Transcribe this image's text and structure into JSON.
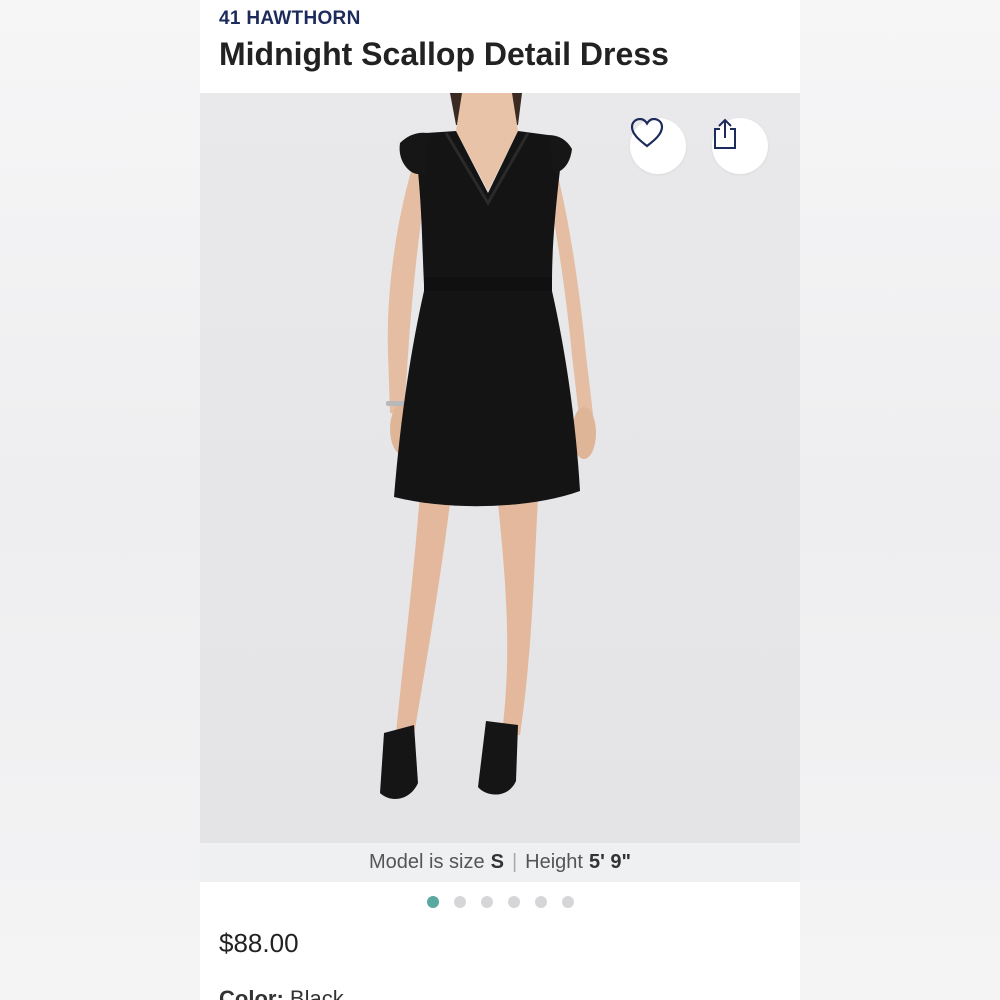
{
  "product": {
    "brand": "41 HAWTHORN",
    "title": "Midnight Scallop Detail Dress",
    "price": "$88.00",
    "color_label": "Color:",
    "color_value": "Black"
  },
  "icons": {
    "favorite": "heart-icon",
    "share": "share-icon"
  },
  "model_info": {
    "size_text": "Model is size",
    "size_value": "S",
    "separator": "|",
    "height_text": "Height",
    "height_value": "5' 9\""
  },
  "carousel": {
    "total": 6,
    "active_index": 0,
    "active_color": "#5aa9a0",
    "inactive_color": "#d6d6d9"
  },
  "colors": {
    "brand": "#1d2b5c",
    "dress": "#141414"
  }
}
